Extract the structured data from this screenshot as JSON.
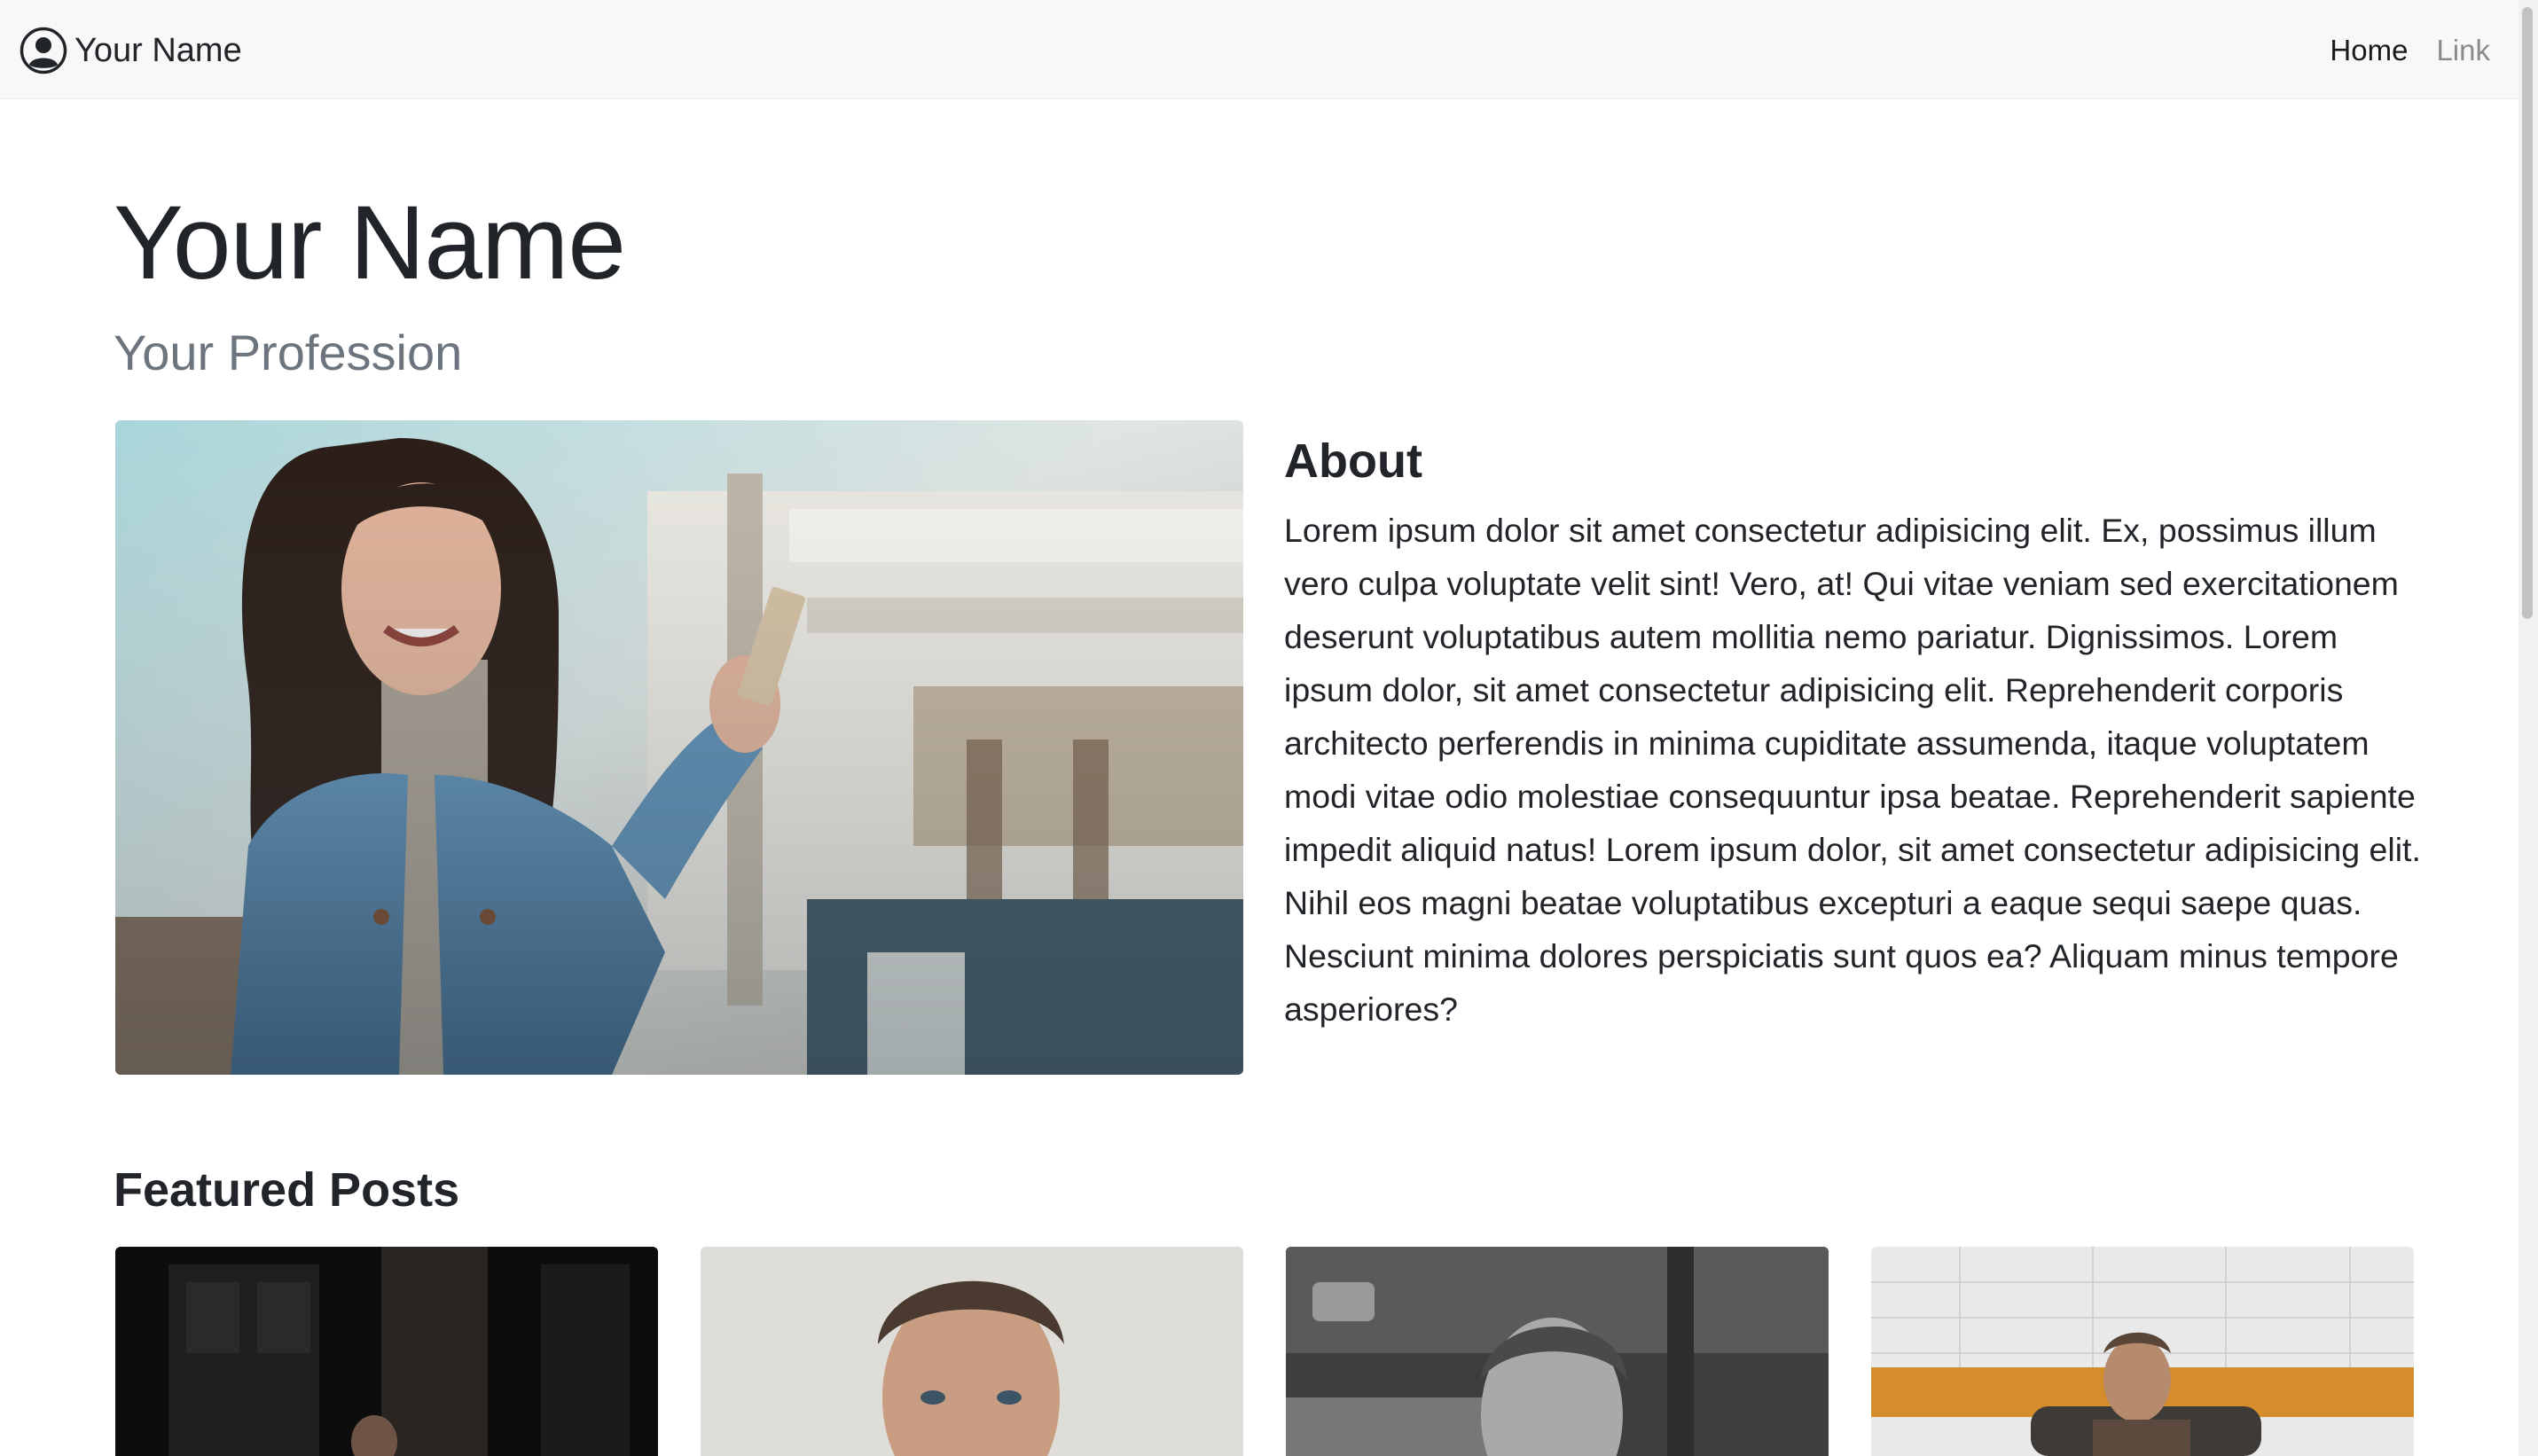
{
  "navbar": {
    "brand_icon": "user-circle-icon",
    "brand": "Your Name",
    "links": [
      {
        "label": "Home",
        "active": true
      },
      {
        "label": "Link",
        "active": false
      }
    ]
  },
  "header": {
    "title": "Your Name",
    "subtitle": "Your Profession"
  },
  "about": {
    "heading": "About",
    "text": "Lorem ipsum dolor sit amet consectetur adipisicing elit. Ex, possimus illum vero culpa voluptate velit sint! Vero, at! Qui vitae veniam sed exercitationem deserunt voluptatibus autem mollitia nemo pariatur. Dignissimos. Lorem ipsum dolor, sit amet consectetur adipisicing elit. Reprehenderit corporis architecto perferendis in minima cupiditate assumenda, itaque voluptatem modi vitae odio molestiae consequuntur ipsa beatae. Reprehenderit sapiente impedit aliquid natus! Lorem ipsum dolor, sit amet consectetur adipisicing elit. Nihil eos magni beatae voluptatibus excepturi a eaque sequi saepe quas. Nesciunt minima dolores perspiciatis sunt quos ea? Aliquam minus tempore asperiores?"
  },
  "featured": {
    "heading": "Featured Posts"
  },
  "colors": {
    "navbar_bg": "#f8f8f8",
    "text": "#212529",
    "muted": "#6c757d"
  }
}
